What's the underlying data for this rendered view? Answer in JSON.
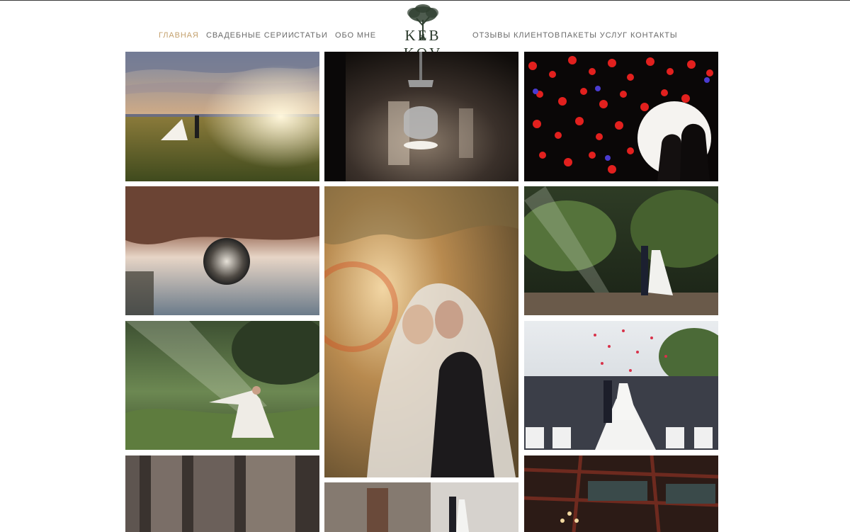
{
  "brand": {
    "logo_text": "KEB KOV"
  },
  "nav": {
    "items": [
      {
        "label": "ГЛАВНАЯ",
        "active": true
      },
      {
        "label": "СВАДЕБНЫЕ СЕРИИ",
        "active": false
      },
      {
        "label": "СТАТЬИ",
        "active": false
      },
      {
        "label": "ОБО МНЕ",
        "active": false
      },
      {
        "label": "ОТЗЫВЫ КЛИЕНТОВ",
        "active": false
      },
      {
        "label": "ПАКЕТЫ УСЛУГ",
        "active": false
      },
      {
        "label": "КОНТАКТЫ",
        "active": false
      }
    ]
  },
  "colors": {
    "accent": "#c4a16e",
    "nav_text": "#6a6a6a",
    "logo": "#2b3a2c"
  },
  "gallery": {
    "photos": [
      "sunset-field-couple-photo",
      "wine-glass-reflection-photo",
      "bokeh-lights-silhouette-photo",
      "water-droplet-reflection-photo",
      "veil-kiss-portrait-photo",
      "forest-path-couple-photo",
      "meadow-dancing-bride-photo",
      "ceremony-aisle-petals-photo",
      "stone-columns-photo",
      "street-couple-photo",
      "ornate-ceiling-chandelier-photo"
    ]
  }
}
